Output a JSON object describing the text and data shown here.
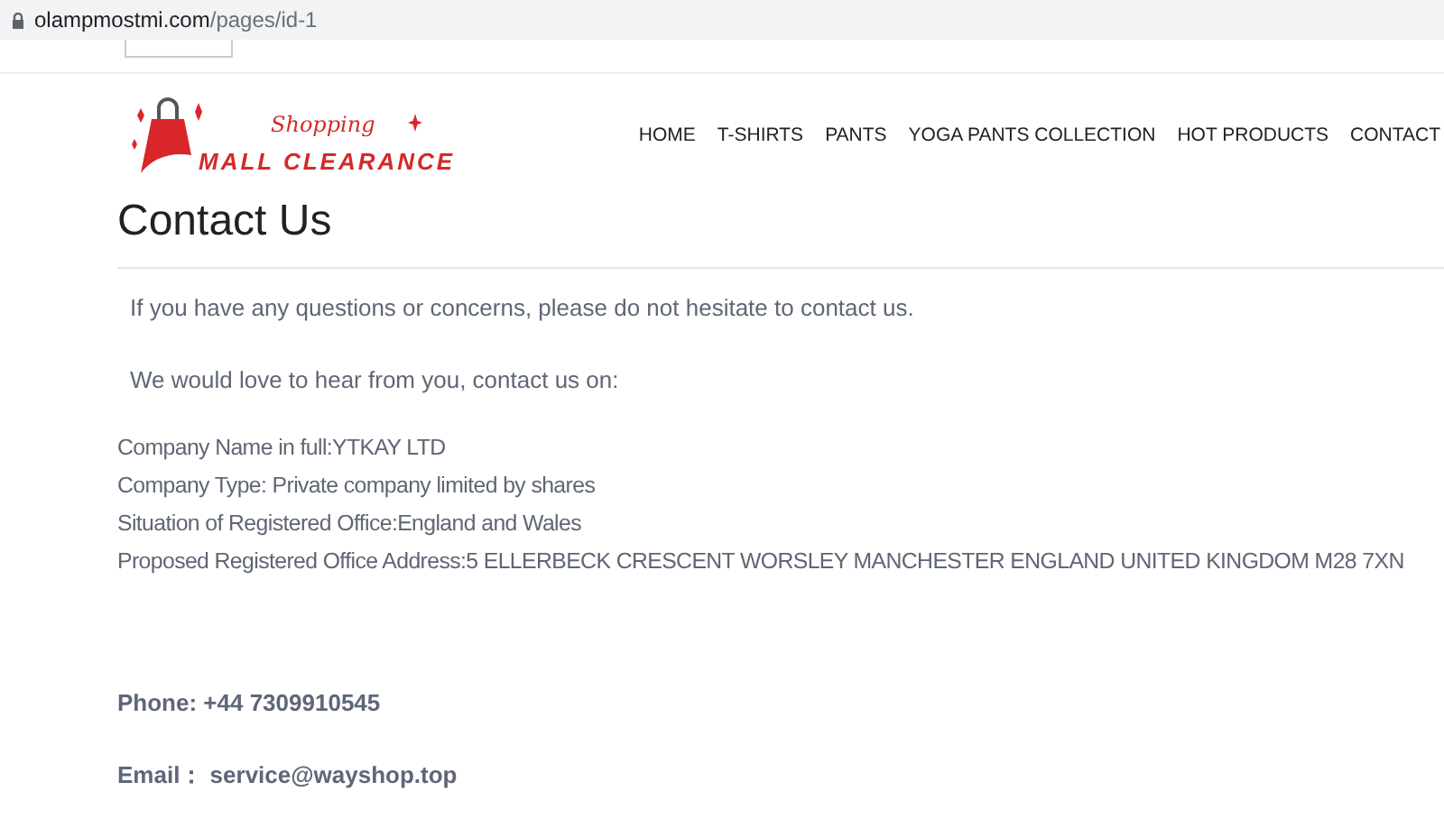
{
  "address_bar": {
    "url_host": "olampmostmi.com",
    "url_path": "/pages/id-1"
  },
  "logo": {
    "script": "Shopping",
    "name": "MALL CLEARANCE"
  },
  "nav": [
    {
      "label": "HOME"
    },
    {
      "label": "T-SHIRTS"
    },
    {
      "label": "PANTS"
    },
    {
      "label": "YOGA PANTS COLLECTION"
    },
    {
      "label": "HOT PRODUCTS"
    },
    {
      "label": "CONTACT"
    }
  ],
  "page_title": "Contact Us",
  "intro": [
    "If you have any questions or concerns, please do not hesitate to contact us.",
    "We would love to hear from you, contact us on:"
  ],
  "company_lines": [
    "Company Name in full:YTKAY LTD",
    "Company Type: Private company limited by shares",
    "Situation of Registered Office:England and Wales",
    "Proposed Registered Office Address:5 ELLERBECK CRESCENT WORSLEY MANCHESTER ENGLAND UNITED KINGDOM M28 7XN"
  ],
  "contacts": [
    "Phone: +44 7309910545",
    "Email： service@wayshop.top"
  ]
}
